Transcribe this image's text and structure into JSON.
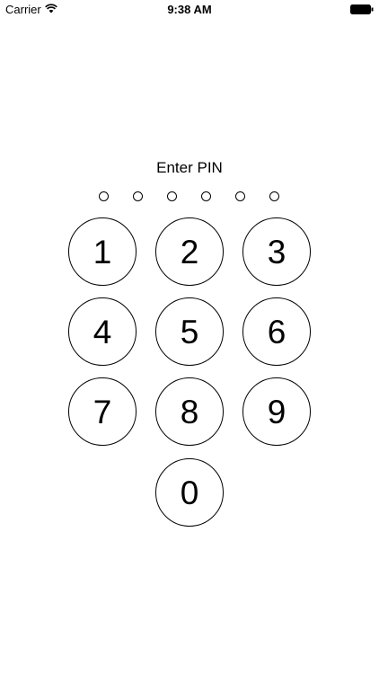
{
  "status_bar": {
    "carrier": "Carrier",
    "time": "9:38 AM",
    "wifi_icon": "wifi-icon",
    "battery_icon": "battery-icon"
  },
  "pin": {
    "title": "Enter PIN",
    "dot_count": 6,
    "entered": 0
  },
  "keypad": {
    "keys": [
      "1",
      "2",
      "3",
      "4",
      "5",
      "6",
      "7",
      "8",
      "9",
      "0"
    ]
  }
}
